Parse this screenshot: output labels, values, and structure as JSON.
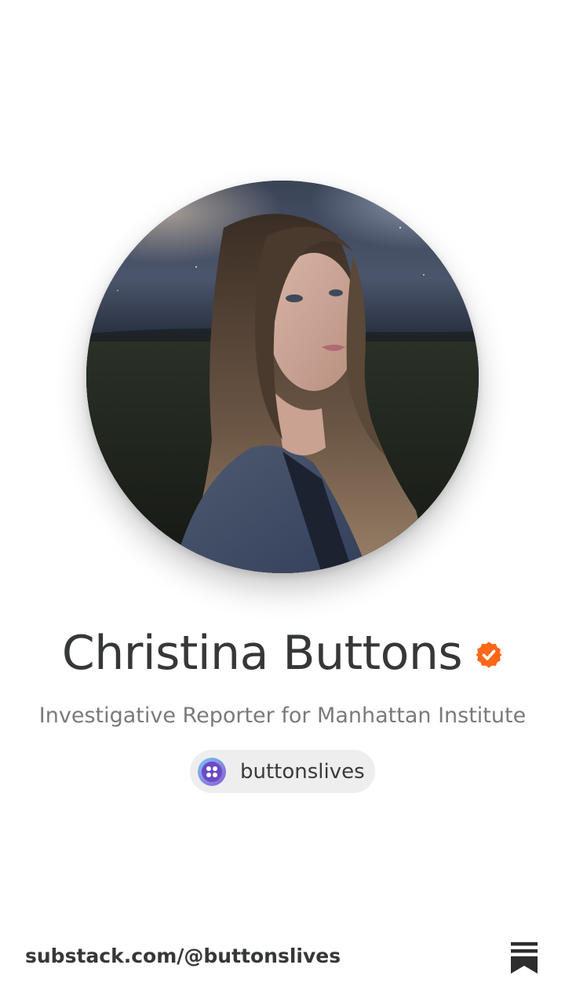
{
  "profile": {
    "name": "Christina Buttons",
    "bio": "Investigative Reporter for Manhattan Institute",
    "handle": "buttonslives",
    "verified": true
  },
  "footer": {
    "url": "substack.com/@buttonslives",
    "logo_icon": "substack-logo-icon"
  },
  "colors": {
    "verified_badge": "#FF6719",
    "name_text": "#363737",
    "bio_text": "#7A7A7A",
    "pill_background": "#EEEEEE"
  }
}
